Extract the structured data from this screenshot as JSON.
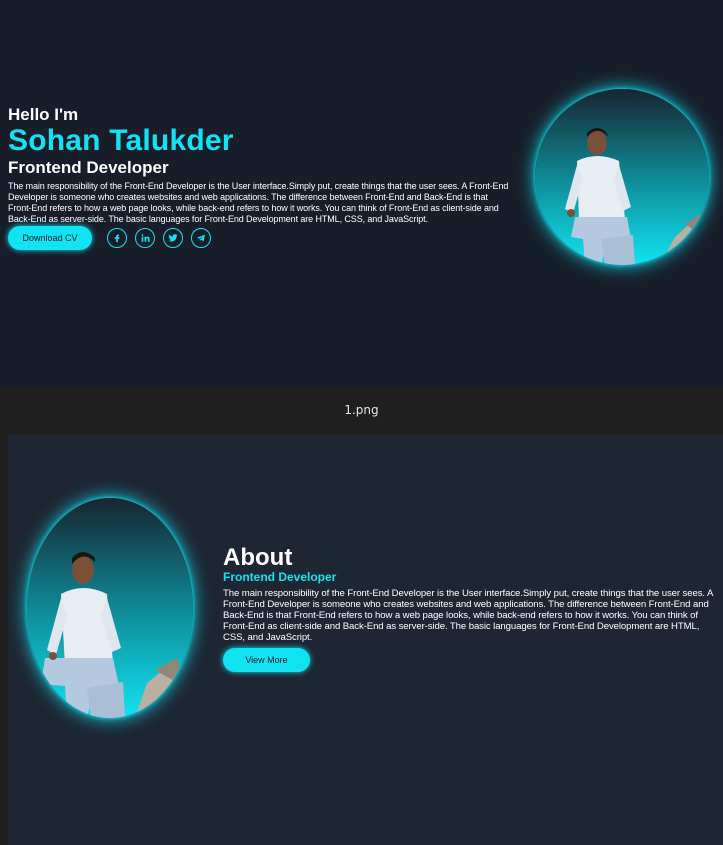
{
  "screen1": {
    "greeting": "Hello I'm",
    "name": "Sohan Talukder",
    "role": "Frontend Developer",
    "description": "The main responsibility of the Front-End Developer is the User interface.Simply put, create things that the user sees. A Front-End Developer is someone who creates websites and web applications. The difference between Front-End and Back-End is that Front-End refers to how a web page looks, while back-end refers to how it works. You can think of Front-End as client-side and Back-End as server-side. The basic languages for Front-End Development are HTML, CSS, and JavaScript.",
    "download_label": "Download CV",
    "socials": [
      {
        "icon": "facebook-icon"
      },
      {
        "icon": "linkedin-icon"
      },
      {
        "icon": "twitter-icon"
      },
      {
        "icon": "telegram-icon"
      }
    ]
  },
  "viewer": {
    "filename": "1.png"
  },
  "screen2": {
    "title": "About",
    "role": "Frontend Developer",
    "description": "The main responsibility of the Front-End Developer is the User interface.Simply put, create things that the user sees. A Front-End Developer is someone who creates websites and web applications. The difference between Front-End and Back-End is that Front-End refers to how a web page looks, while back-end refers to how it works. You can think of Front-End as client-side and Back-End as server-side. The basic languages for Front-End Development are HTML, CSS, and JavaScript.",
    "view_more_label": "View More"
  },
  "colors": {
    "accent": "#11e3f2",
    "background_dark": "#171e2a",
    "background_panel": "#1e2633"
  }
}
